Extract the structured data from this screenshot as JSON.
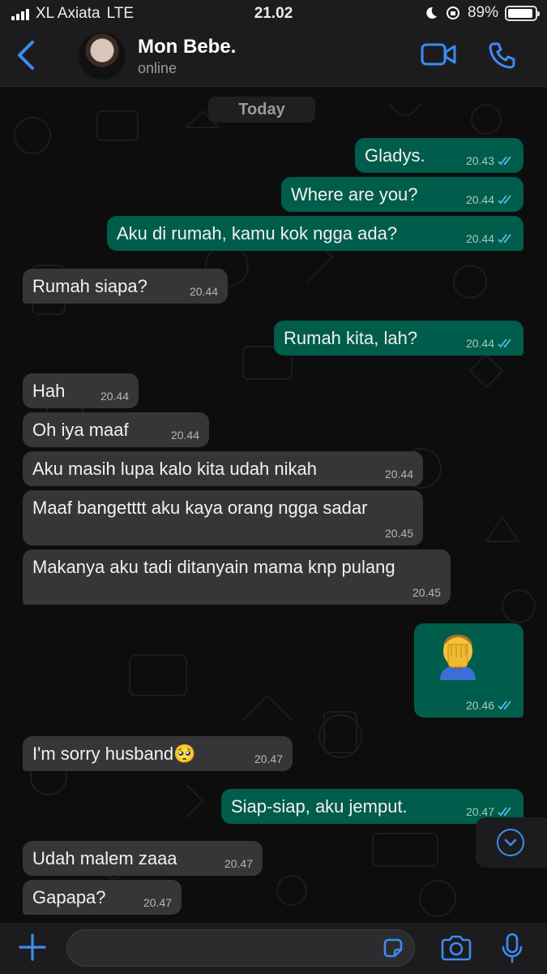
{
  "status_bar": {
    "carrier": "XL Axiata",
    "network": "LTE",
    "time": "21.02",
    "battery": "89%"
  },
  "header": {
    "contact_name": "Mon Bebe.",
    "presence": "online"
  },
  "chat": {
    "date_label": "Today",
    "messages": [
      {
        "dir": "out",
        "text": "Gladys.",
        "time": "20.43"
      },
      {
        "dir": "out",
        "text": "Where are you?",
        "time": "20.44"
      },
      {
        "dir": "out",
        "text": "Aku di rumah, kamu kok ngga ada?",
        "time": "20.44"
      },
      {
        "dir": "in",
        "text": "Rumah siapa?",
        "time": "20.44"
      },
      {
        "dir": "out",
        "text": "Rumah kita, lah?",
        "time": "20.44"
      },
      {
        "dir": "in",
        "text": "Hah",
        "time": "20.44"
      },
      {
        "dir": "in",
        "text": "Oh iya maaf",
        "time": "20.44"
      },
      {
        "dir": "in",
        "text": "Aku masih lupa kalo kita udah nikah",
        "time": "20.44"
      },
      {
        "dir": "in",
        "text": "Maaf bangetttt aku kaya orang ngga sadar",
        "time": "20.45"
      },
      {
        "dir": "in",
        "text": "Makanya aku tadi ditanyain mama knp pulang",
        "time": "20.45"
      },
      {
        "dir": "out",
        "text": "",
        "emoji": "man-facepalming",
        "time": "20.46"
      },
      {
        "dir": "in",
        "text": "I'm sorry husband🥺",
        "time": "20.47"
      },
      {
        "dir": "out",
        "text": "Siap-siap, aku jemput.",
        "time": "20.47"
      },
      {
        "dir": "in",
        "text": "Udah malem zaaa",
        "time": "20.47"
      },
      {
        "dir": "in",
        "text": "Gapapa?",
        "time": "20.47"
      }
    ]
  },
  "composer": {
    "placeholder": ""
  },
  "colors": {
    "accent": "#3d8bf2",
    "outgoing_bubble": "#005c4b",
    "incoming_bubble": "#363638",
    "read_ticks": "#53bdeb"
  }
}
